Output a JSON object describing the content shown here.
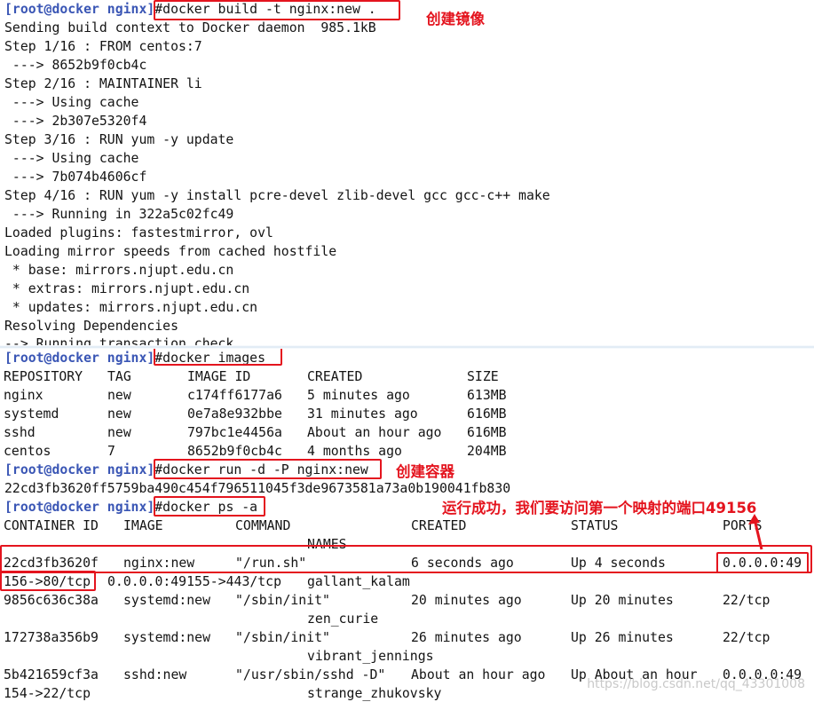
{
  "build_panel": {
    "prompt": "[root@docker nginx]",
    "command": "#docker build -t nginx:new .",
    "annotation": "创建镜像",
    "output_lines": [
      "Sending build context to Docker daemon  985.1kB",
      "Step 1/16 : FROM centos:7",
      " ---> 8652b9f0cb4c",
      "Step 2/16 : MAINTAINER li",
      " ---> Using cache",
      " ---> 2b307e5320f4",
      "Step 3/16 : RUN yum -y update",
      " ---> Using cache",
      " ---> 7b074b4606cf",
      "Step 4/16 : RUN yum -y install pcre-devel zlib-devel gcc gcc-c++ make",
      " ---> Running in 322a5c02fc49",
      "Loaded plugins: fastestmirror, ovl",
      "Loading mirror speeds from cached hostfile",
      " * base: mirrors.njupt.edu.cn",
      " * extras: mirrors.njupt.edu.cn",
      " * updates: mirrors.njupt.edu.cn",
      "Resolving Dependencies"
    ],
    "cut_line": "--> Running transaction check"
  },
  "images_panel": {
    "prompt": "[root@docker nginx]",
    "command": "#docker images",
    "headers": [
      "REPOSITORY",
      "TAG",
      "IMAGE ID",
      "CREATED",
      "SIZE"
    ],
    "rows": [
      [
        "nginx",
        "new",
        "c174ff6177a6",
        "5 minutes ago",
        "613MB"
      ],
      [
        "systemd",
        "new",
        "0e7a8e932bbe",
        "31 minutes ago",
        "616MB"
      ],
      [
        "sshd",
        "new",
        "797bc1e4456a",
        "About an hour ago",
        "616MB"
      ],
      [
        "centos",
        "7",
        "8652b9f0cb4c",
        "4 months ago",
        "204MB"
      ]
    ]
  },
  "run_section": {
    "prompt": "[root@docker nginx]",
    "command": "#docker run -d -P nginx:new",
    "annotation": "创建容器",
    "output": "22cd3fb3620ff5759ba490c454f796511045f3de9673581a73a0b190041fb830"
  },
  "ps_section": {
    "prompt": "[root@docker nginx]",
    "command": "#docker ps -a",
    "annotation": "运行成功，我们要访问第一个映射的端口49156",
    "headers": [
      "CONTAINER ID",
      "IMAGE",
      "COMMAND",
      "CREATED",
      "STATUS",
      "PORTS",
      "NAMES"
    ],
    "rows": [
      {
        "id": "22cd3fb3620f",
        "image": "nginx:new",
        "command": "\"/run.sh\"",
        "created": "6 seconds ago",
        "status": "Up 4 seconds",
        "ports": "0.0.0.0:49",
        "wrap_ports": "156->80/tcp",
        "wrap_rest": "0.0.0.0:49155->443/tcp",
        "name": "gallant_kalam"
      },
      {
        "id": "9856c636c38a",
        "image": "systemd:new",
        "command": "\"/sbin/init\"",
        "created": "20 minutes ago",
        "status": "Up 20 minutes",
        "ports": "22/tcp",
        "wrap_ports": "",
        "wrap_rest": "",
        "name": "zen_curie"
      },
      {
        "id": "172738a356b9",
        "image": "systemd:new",
        "command": "\"/sbin/init\"",
        "created": "26 minutes ago",
        "status": "Up 26 minutes",
        "ports": "22/tcp",
        "wrap_ports": "",
        "wrap_rest": "",
        "name": "vibrant_jennings"
      },
      {
        "id": "5b421659cf3a",
        "image": "sshd:new",
        "command": "\"/usr/sbin/sshd -D\"",
        "created": "About an hour ago",
        "status": "Up About an hour",
        "ports": "0.0.0.0:49",
        "wrap_ports": "154->22/tcp",
        "wrap_rest": "",
        "name": "strange_zhukovsky"
      }
    ]
  },
  "watermark": "https://blog.csdn.net/qq_43301008",
  "colors": {
    "prompt": "#3a56b5",
    "annotation": "#e4141e",
    "text": "#141414"
  }
}
